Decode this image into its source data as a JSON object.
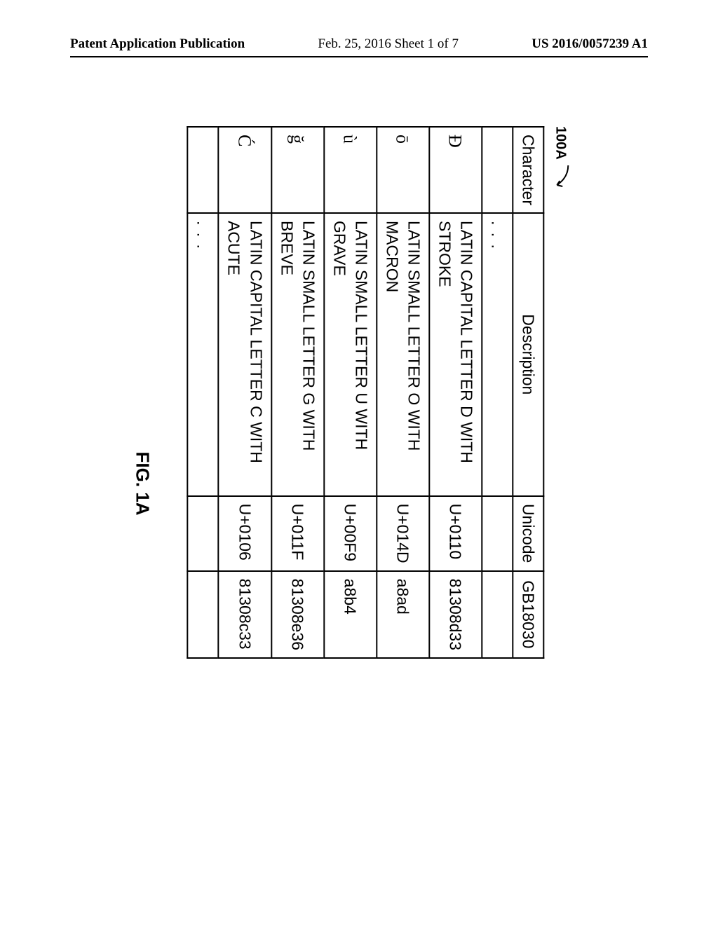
{
  "header": {
    "left": "Patent Application Publication",
    "center": "Feb. 25, 2016  Sheet 1 of 7",
    "right": "US 2016/0057239 A1"
  },
  "figure": {
    "ref_label": "100A",
    "caption": "FIG. 1A",
    "columns": [
      "Character",
      "Description",
      "Unicode",
      "GB18030"
    ],
    "ellipsis_before": ". . .",
    "ellipsis_after": ". . .",
    "rows": [
      {
        "char": "Đ",
        "desc": "LATIN CAPITAL LETTER D WITH STROKE",
        "unicode": "U+0110",
        "gb": "81308d33"
      },
      {
        "char": "ō",
        "desc": "LATIN SMALL LETTER O WITH MACRON",
        "unicode": "U+014D",
        "gb": "a8ad"
      },
      {
        "char": "ù",
        "desc": "LATIN SMALL LETTER U WITH GRAVE",
        "unicode": "U+00F9",
        "gb": "a8b4"
      },
      {
        "char": "ğ",
        "desc": "LATIN SMALL LETTER G WITH BREVE",
        "unicode": "U+011F",
        "gb": "81308e36"
      },
      {
        "char": "Ć",
        "desc": "LATIN CAPITAL LETTER C WITH ACUTE",
        "unicode": "U+0106",
        "gb": "81308c33"
      }
    ]
  }
}
